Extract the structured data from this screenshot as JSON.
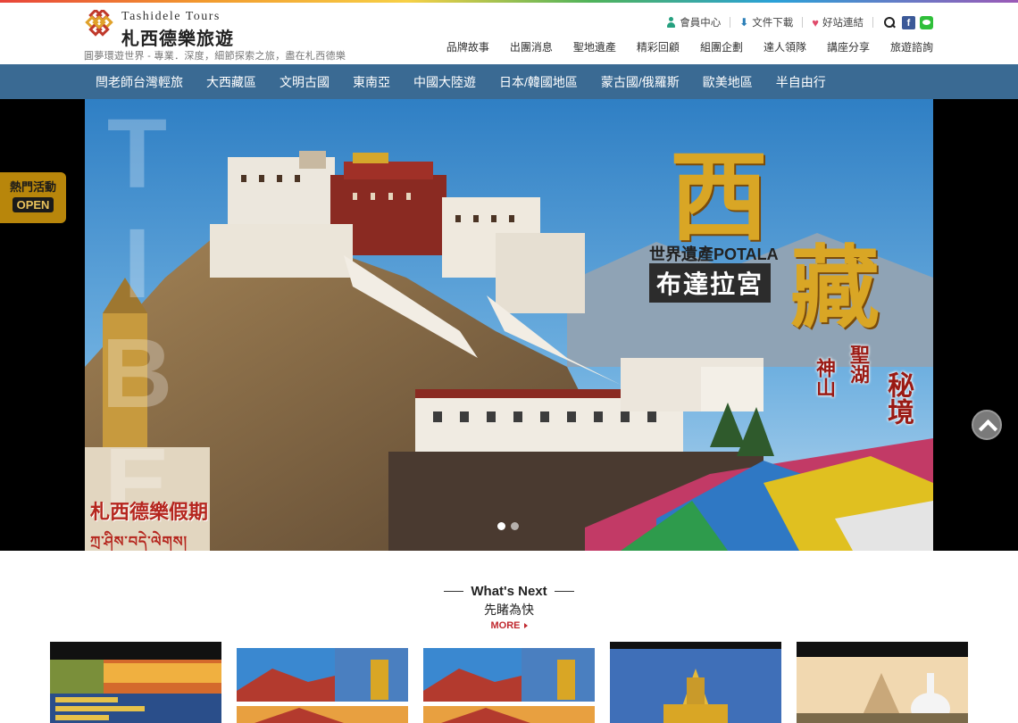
{
  "brand": {
    "name_en": "Tashidele Tours",
    "name_zh": "札西德樂旅遊",
    "tagline": "圓夢環遊世界 - 專業．深度，細節探索之旅，盡在札西德樂"
  },
  "utility": {
    "member": "會員中心",
    "download": "文件下載",
    "links": "好站連結",
    "facebook": "f"
  },
  "topnav": [
    "品牌故事",
    "出團消息",
    "聖地遺產",
    "精彩回顧",
    "組團企劃",
    "達人領隊",
    "講座分享",
    "旅遊諮詢"
  ],
  "categories": [
    "閆老師台灣輕旅",
    "大西藏區",
    "文明古國",
    "東南亞",
    "中國大陸遊",
    "日本/韓國地區",
    "蒙古國/俄羅斯",
    "歐美地區",
    "半自由行"
  ],
  "hero": {
    "title_1": "西",
    "title_2": "藏",
    "heritage": "世界遺產POTALA",
    "palace": "布達拉宮",
    "phrase_1": "神山",
    "phrase_2": "聖湖",
    "phrase_3": "秘境",
    "brand": "札西德樂假期",
    "watermark": "TIBET"
  },
  "hot": {
    "label": "熱門活動",
    "open": "OPEN"
  },
  "next": {
    "title": "What's Next",
    "subtitle": "先睹為快",
    "more": "MORE"
  },
  "colors": {
    "nav_bar": "#3a6a93",
    "accent_red": "#c0282e",
    "gold": "#d9a625"
  }
}
